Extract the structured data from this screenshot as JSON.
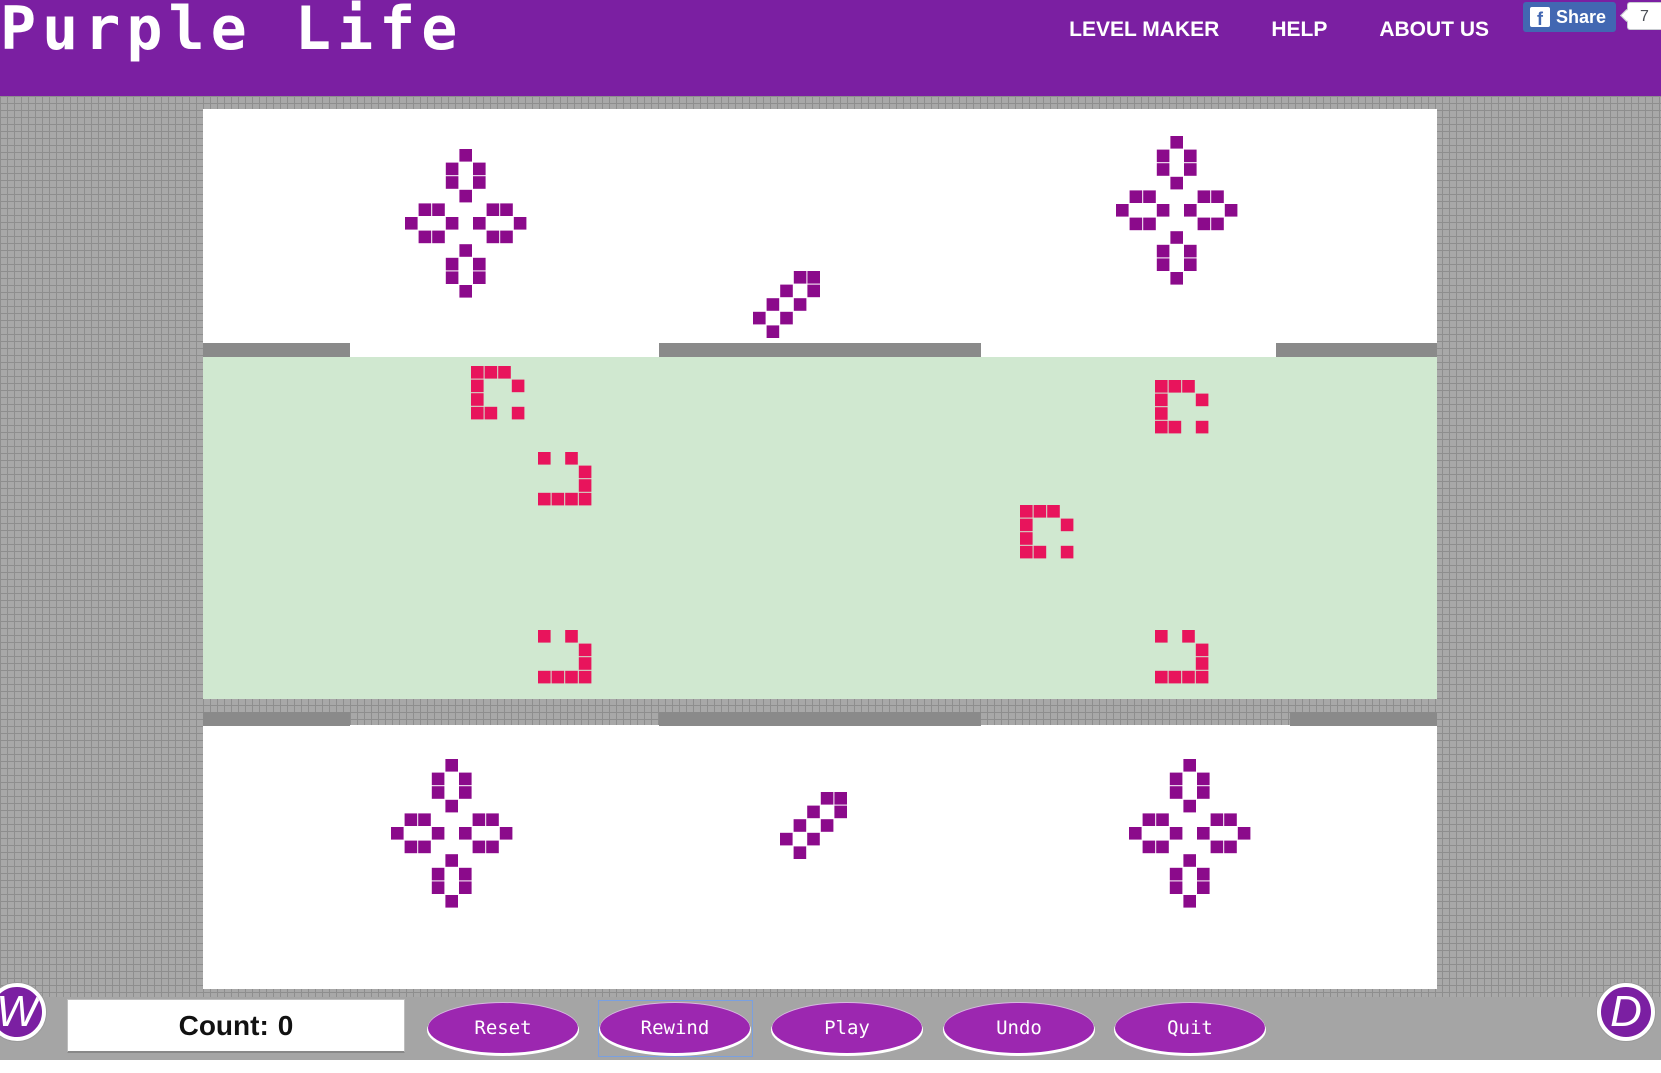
{
  "header": {
    "logo": "Purple Life",
    "nav": [
      "LEVEL MAKER",
      "HELP",
      "ABOUT US"
    ],
    "share_label": "Share",
    "share_count": "7"
  },
  "colors": {
    "header_bg": "#7b1fa2",
    "live_cell": "#8b0a8b",
    "enemy_cell": "#e8145c",
    "zone_bg": "#d0e8d0",
    "board_bg": "#ffffff",
    "button_bg": "#9c27b0"
  },
  "controls": {
    "left_circle": "W",
    "right_circle": "D",
    "count_label": "Count:",
    "count_value": "0",
    "buttons": [
      "Reset",
      "Rewind",
      "Play",
      "Undo",
      "Quit"
    ]
  },
  "icons": {
    "share": "facebook-f-icon"
  }
}
